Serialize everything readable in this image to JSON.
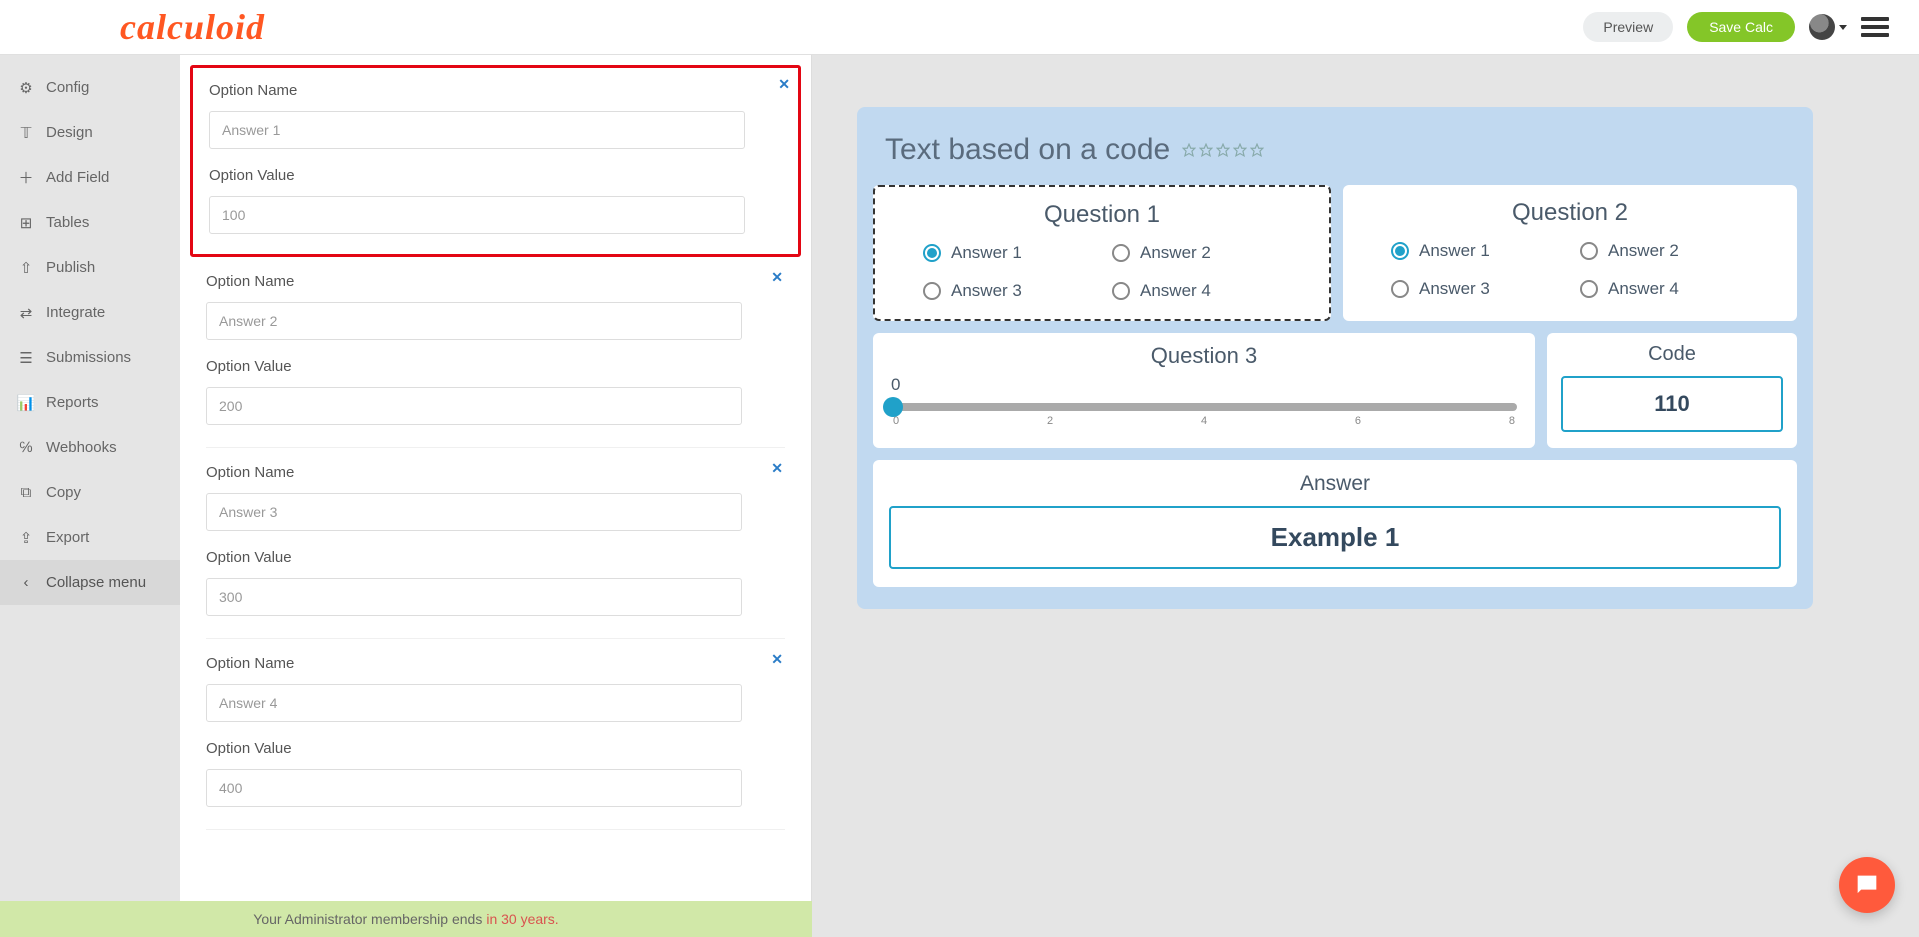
{
  "brand": "calculoid",
  "topbar": {
    "preview": "Preview",
    "save": "Save Calc"
  },
  "sidebar": {
    "items": [
      {
        "label": "Config",
        "icon": "gear"
      },
      {
        "label": "Design",
        "icon": "design"
      },
      {
        "label": "Add Field",
        "icon": "plus"
      },
      {
        "label": "Tables",
        "icon": "table"
      },
      {
        "label": "Publish",
        "icon": "upload"
      },
      {
        "label": "Integrate",
        "icon": "plug"
      },
      {
        "label": "Submissions",
        "icon": "list"
      },
      {
        "label": "Reports",
        "icon": "chart"
      },
      {
        "label": "Webhooks",
        "icon": "hook"
      },
      {
        "label": "Copy",
        "icon": "copy"
      },
      {
        "label": "Export",
        "icon": "export"
      }
    ],
    "collapse": "Collapse menu"
  },
  "editor": {
    "nameLabel": "Option Name",
    "valueLabel": "Option Value",
    "options": [
      {
        "name": "Answer 1",
        "value": "100"
      },
      {
        "name": "Answer 2",
        "value": "200"
      },
      {
        "name": "Answer 3",
        "value": "300"
      },
      {
        "name": "Answer 4",
        "value": "400"
      }
    ]
  },
  "calc": {
    "title": "Text based on a code",
    "q1": {
      "title": "Question 1",
      "answers": [
        "Answer 1",
        "Answer 2",
        "Answer 3",
        "Answer 4"
      ]
    },
    "q2": {
      "title": "Question 2",
      "answers": [
        "Answer 1",
        "Answer 2",
        "Answer 3",
        "Answer 4"
      ]
    },
    "q3": {
      "title": "Question 3",
      "current": "0",
      "ticks": [
        "0",
        "2",
        "4",
        "6",
        "8"
      ]
    },
    "code": {
      "title": "Code",
      "value": "110"
    },
    "answer": {
      "title": "Answer",
      "result": "Example 1"
    }
  },
  "footer": {
    "text": "Your Administrator membership ends",
    "highlight": "in 30 years."
  }
}
